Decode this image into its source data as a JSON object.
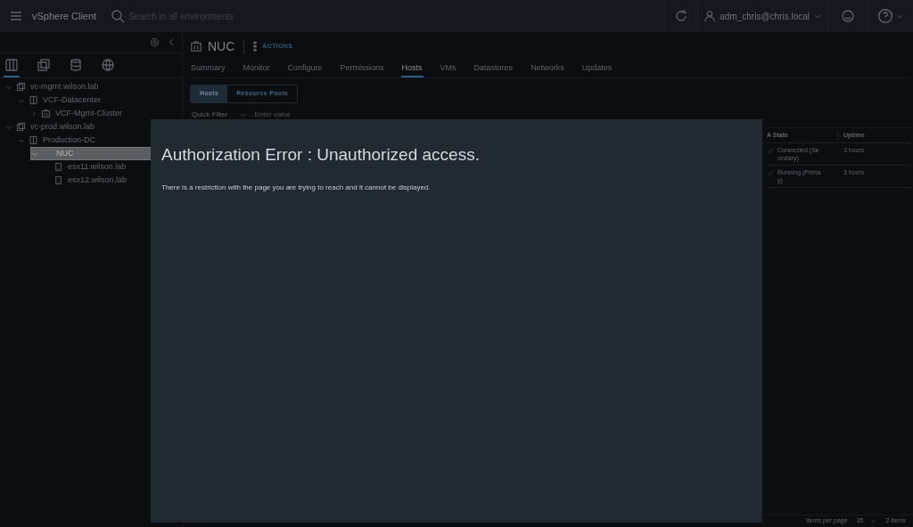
{
  "header": {
    "app_title": "vSphere Client",
    "search_placeholder": "Search in all environments",
    "user": "adm_chris@chris.local"
  },
  "sidebar": {
    "views": [
      {
        "kind": "hosts",
        "selected": true
      },
      {
        "kind": "vms",
        "selected": false
      },
      {
        "kind": "storage",
        "selected": false
      },
      {
        "kind": "network",
        "selected": false
      }
    ],
    "tree": [
      {
        "label": "vc-mgmt.wilson.lab",
        "kind": "vcenter",
        "expanded": true,
        "selected": false,
        "children": [
          {
            "label": "VCF-Datacenter",
            "kind": "datacenter",
            "expanded": true,
            "selected": false,
            "children": [
              {
                "label": "VCF-Mgmt-Cluster",
                "kind": "cluster",
                "expanded": false,
                "selected": false
              }
            ]
          }
        ]
      },
      {
        "label": "vc-prod.wilson.lab",
        "kind": "vcenter",
        "expanded": true,
        "selected": false,
        "children": [
          {
            "label": "Production-DC",
            "kind": "datacenter",
            "expanded": true,
            "selected": false,
            "children": [
              {
                "label": "NUC",
                "kind": "cluster",
                "expanded": true,
                "selected": true,
                "children": [
                  {
                    "label": "esx11.wilson.lab",
                    "kind": "host",
                    "selected": false
                  },
                  {
                    "label": "esx12.wilson.lab",
                    "kind": "host",
                    "selected": false
                  }
                ]
              }
            ]
          }
        ]
      }
    ]
  },
  "object": {
    "title": "NUC",
    "actions": "ACTIONS"
  },
  "tabs": [
    {
      "label": "Summary",
      "selected": false
    },
    {
      "label": "Monitor",
      "selected": false
    },
    {
      "label": "Configure",
      "selected": false
    },
    {
      "label": "Permissions",
      "selected": false
    },
    {
      "label": "Hosts",
      "selected": true
    },
    {
      "label": "VMs",
      "selected": false
    },
    {
      "label": "Datastores",
      "selected": false
    },
    {
      "label": "Networks",
      "selected": false
    },
    {
      "label": "Updates",
      "selected": false
    }
  ],
  "subtabs": [
    {
      "label": "Hosts",
      "selected": true
    },
    {
      "label": "Resource Pools",
      "selected": false
    }
  ],
  "filter": {
    "label": "Quick Filter",
    "placeholder": "Enter value"
  },
  "table": {
    "columns": [
      "A State",
      "Uptime"
    ],
    "rows": [
      {
        "cells": [
          [
            "Connected (Se",
            "ondary)"
          ],
          [
            "3 hours"
          ]
        ]
      },
      {
        "cells": [
          [
            "Running (Prima",
            "y)"
          ],
          [
            "3 hours"
          ]
        ]
      }
    ]
  },
  "footer": {
    "items_per_page_label": "Items per page",
    "items_per_page": "35",
    "count": "2 items"
  },
  "dialog": {
    "title": "Authorization Error : Unauthorized access.",
    "message": "There is a restriction with the page you are trying to reach and it cannot be displayed."
  }
}
